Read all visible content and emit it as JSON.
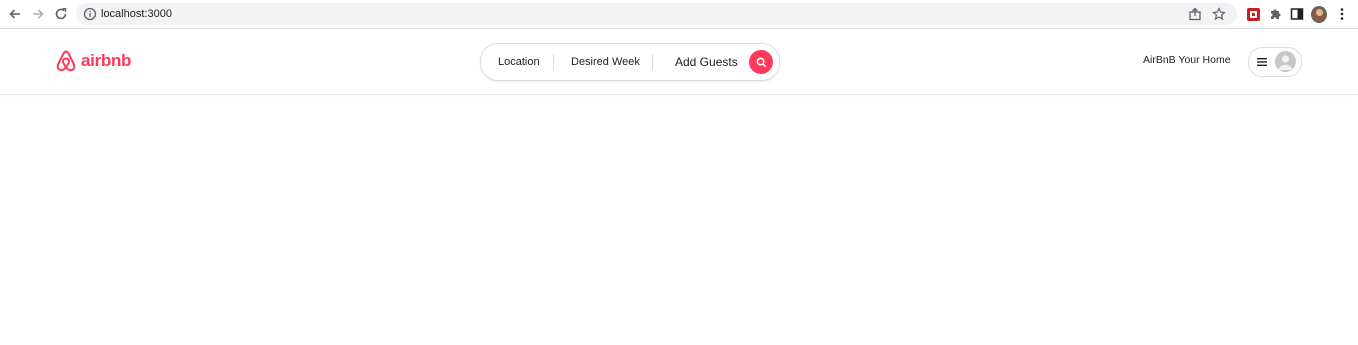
{
  "browser": {
    "url": "localhost:3000",
    "icons": {
      "back": "arrow-left-icon",
      "forward": "arrow-right-icon",
      "reload": "reload-icon",
      "info": "info-icon",
      "share": "share-icon",
      "bookmark": "star-icon",
      "extension": "extension-icon",
      "puzzle": "puzzle-icon",
      "sidepanel": "side-panel-icon",
      "profile": "profile-avatar",
      "menu": "kebab-menu-icon"
    }
  },
  "header": {
    "logo_text": "airbnb",
    "brand_color": "#FF385C",
    "search": {
      "location_label": "Location",
      "week_label": "Desired Week",
      "guests_label": "Add Guests"
    },
    "host_link": "AirBnB Your Home"
  }
}
